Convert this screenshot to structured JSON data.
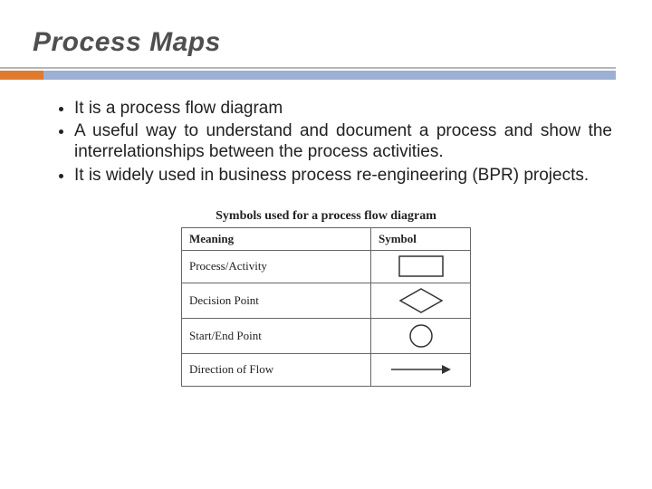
{
  "title": "Process Maps",
  "bullets": [
    "It is a process flow diagram",
    "A useful way to understand and document a process and show the interrelationships between the process activities.",
    "It is widely used in business process re-engineering (BPR) projects."
  ],
  "table": {
    "caption": "Symbols used for a process flow diagram",
    "headers": {
      "meaning": "Meaning",
      "symbol": "Symbol"
    },
    "rows": [
      {
        "meaning": "Process/Activity",
        "symbol_name": "rectangle"
      },
      {
        "meaning": "Decision Point",
        "symbol_name": "diamond"
      },
      {
        "meaning": "Start/End Point",
        "symbol_name": "circle"
      },
      {
        "meaning": "Direction of Flow",
        "symbol_name": "arrow"
      }
    ]
  },
  "colors": {
    "accent": "#e07b2e",
    "band": "#9bb0d4"
  }
}
